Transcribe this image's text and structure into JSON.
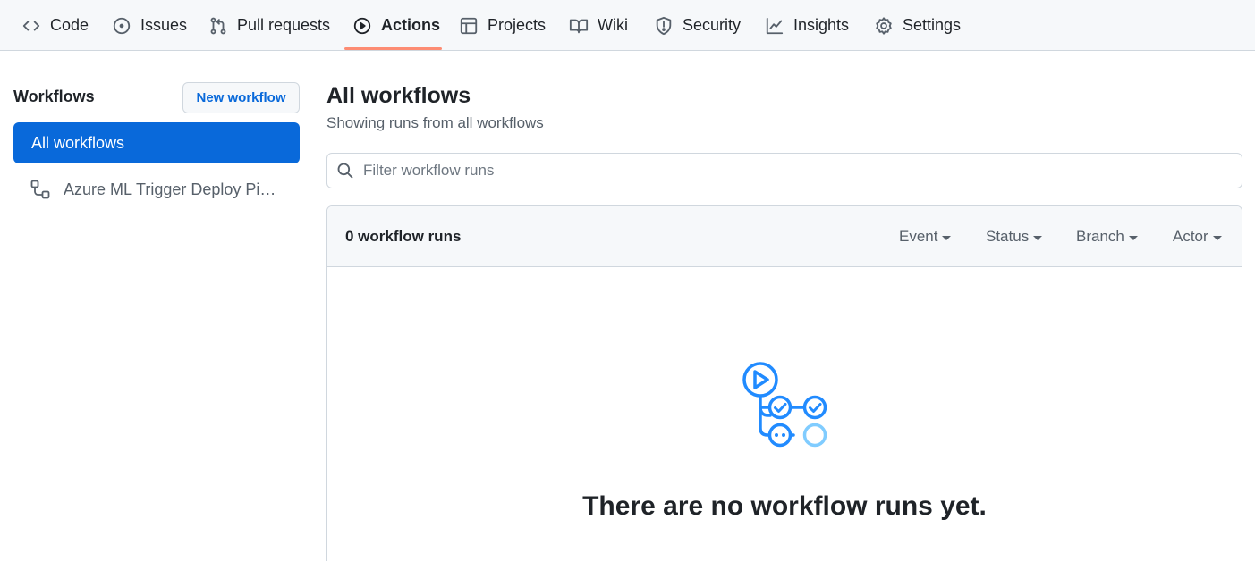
{
  "repo_nav": {
    "tabs": [
      {
        "label": "Code",
        "icon": "code-icon"
      },
      {
        "label": "Issues",
        "icon": "issue-icon"
      },
      {
        "label": "Pull requests",
        "icon": "pull-request-icon"
      },
      {
        "label": "Actions",
        "icon": "play-icon",
        "active": true
      },
      {
        "label": "Projects",
        "icon": "table-icon"
      },
      {
        "label": "Wiki",
        "icon": "book-icon"
      },
      {
        "label": "Security",
        "icon": "shield-icon"
      },
      {
        "label": "Insights",
        "icon": "graph-icon"
      },
      {
        "label": "Settings",
        "icon": "gear-icon"
      }
    ],
    "active_underline_color": "#fd8c73"
  },
  "sidebar": {
    "title": "Workflows",
    "new_workflow_label": "New workflow",
    "items": [
      {
        "label": "All workflows",
        "active": true
      },
      {
        "label": "Azure ML Trigger Deploy Pipe...",
        "icon": "workflow-icon"
      }
    ]
  },
  "main": {
    "title": "All workflows",
    "subtitle": "Showing runs from all workflows",
    "filter_placeholder": "Filter workflow runs",
    "runs": {
      "count_label": "0 workflow runs",
      "filters": [
        "Event",
        "Status",
        "Branch",
        "Actor"
      ],
      "empty_message": "There are no workflow runs yet."
    }
  },
  "colors": {
    "accent": "#0969da",
    "illustration": "#218bff",
    "illustration_light": "#80ccff"
  }
}
